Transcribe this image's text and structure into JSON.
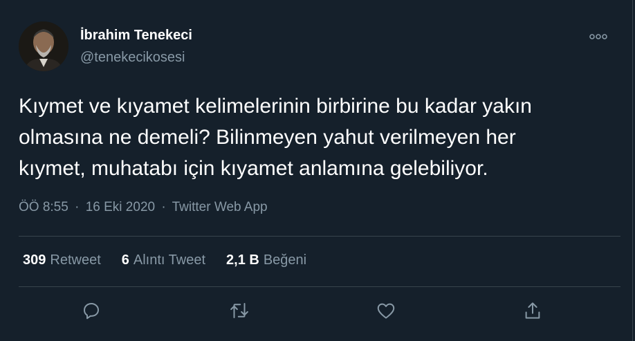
{
  "author": {
    "name": "İbrahim Tenekeci",
    "handle": "@tenekecikosesi"
  },
  "tweet": {
    "lines": [
      "Kıymet ve kıyamet kelimelerinin birbirine bu kadar yakın",
      "olmasına ne demeli? Bilinmeyen yahut verilmeyen her",
      "kıymet, muhatabı için kıyamet anlamına gelebiliyor."
    ],
    "time": "ÖÖ 8:55",
    "date": "16 Eki 2020",
    "source": "Twitter Web App",
    "separator": "·"
  },
  "stats": {
    "retweets": {
      "count": "309",
      "label": "Retweet"
    },
    "quotes": {
      "count": "6",
      "label": "Alıntı Tweet"
    },
    "likes": {
      "count": "2,1 B",
      "label": "Beğeni"
    }
  },
  "icons": {
    "more": "more-horizontal-icon",
    "reply": "reply-icon",
    "retweet": "retweet-icon",
    "like": "heart-icon",
    "share": "share-icon"
  },
  "colors": {
    "background": "#15202b",
    "text": "#ffffff",
    "secondary": "#8899a6",
    "divider": "#38444d"
  }
}
